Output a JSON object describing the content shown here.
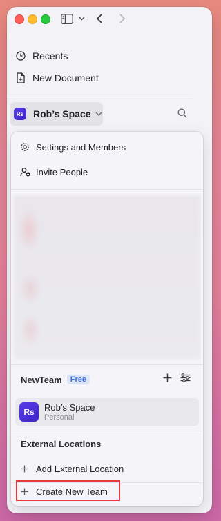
{
  "sidebar": {
    "nav": [
      {
        "label": "Recents",
        "icon": "clock-icon"
      },
      {
        "label": "New Document",
        "icon": "new-document-icon"
      }
    ],
    "space": {
      "initials": "Rs",
      "name": "Rob’s Space"
    }
  },
  "menu": {
    "items": [
      {
        "label": "Settings and Members",
        "icon": "gear-icon"
      },
      {
        "label": "Invite People",
        "icon": "invite-people-icon"
      }
    ],
    "team": {
      "name": "NewTeam",
      "badge": "Free"
    },
    "space_entry": {
      "initials": "Rs",
      "name": "Rob’s Space",
      "subtitle": "Personal"
    },
    "external_locations": {
      "title": "External Locations",
      "add_label": "Add External Location"
    },
    "create_team_label": "Create New Team"
  },
  "colors": {
    "accent": "#4a32d9",
    "highlight_border": "#e43a3a",
    "badge_text": "#3a6fd8",
    "badge_bg": "#dde6f8"
  }
}
